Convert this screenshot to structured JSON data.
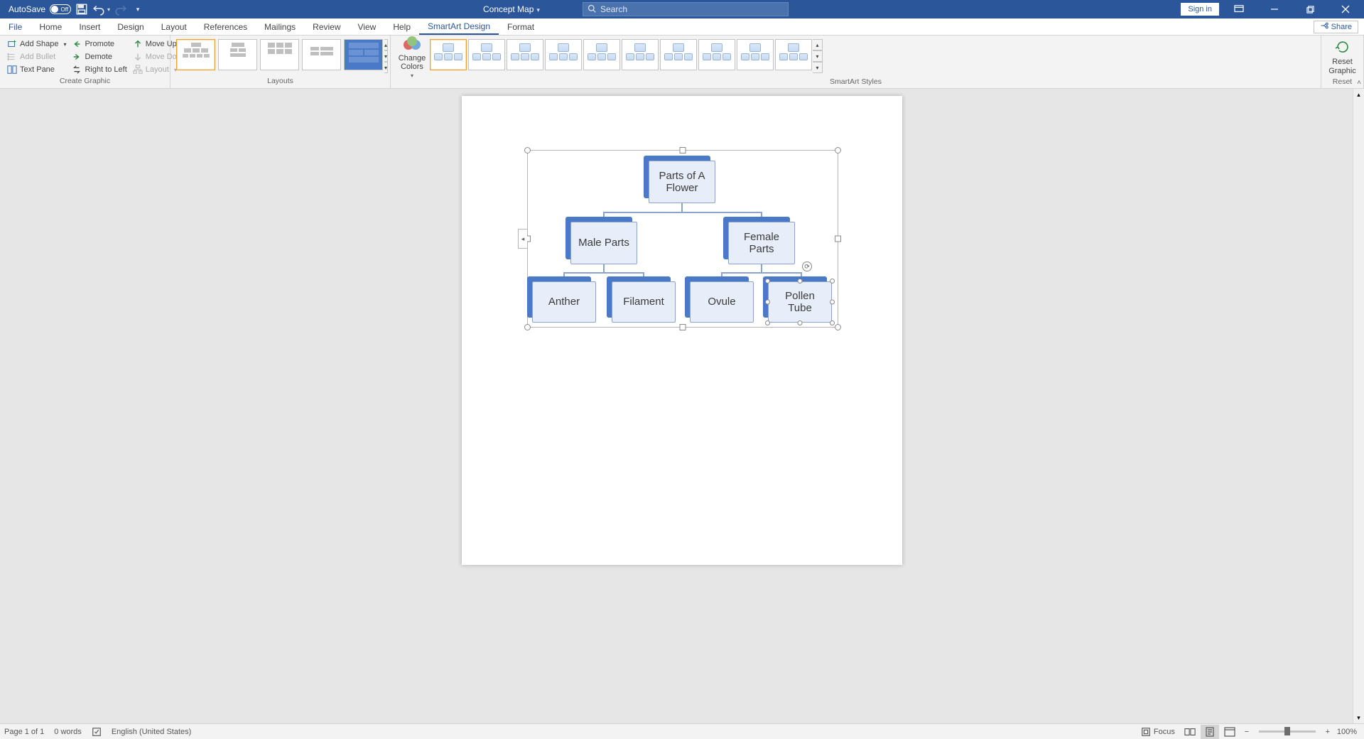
{
  "titlebar": {
    "autosave_label": "AutoSave",
    "autosave_state": "Off",
    "doc_title": "Concept Map",
    "search_placeholder": "Search",
    "signin_label": "Sign in"
  },
  "tabs": {
    "file": "File",
    "home": "Home",
    "insert": "Insert",
    "design": "Design",
    "layout": "Layout",
    "references": "References",
    "mailings": "Mailings",
    "review": "Review",
    "view": "View",
    "help": "Help",
    "smartart": "SmartArt Design",
    "format": "Format",
    "share": "Share"
  },
  "ribbon": {
    "create_graphic": {
      "label": "Create Graphic",
      "add_shape": "Add Shape",
      "add_bullet": "Add Bullet",
      "text_pane": "Text Pane",
      "promote": "Promote",
      "demote": "Demote",
      "right_to_left": "Right to Left",
      "move_up": "Move Up",
      "move_down": "Move Down",
      "layout_btn": "Layout"
    },
    "layouts": {
      "label": "Layouts"
    },
    "styles": {
      "label": "SmartArt Styles",
      "change_colors": "Change Colors"
    },
    "reset": {
      "label": "Reset",
      "reset_graphic": "Reset Graphic"
    }
  },
  "smartart": {
    "root": "Parts of A Flower",
    "l2a": "Male Parts",
    "l2b": "Female Parts",
    "l3a": "Anther",
    "l3b": "Filament",
    "l3c": "Ovule",
    "l3d": "Pollen Tube"
  },
  "statusbar": {
    "page": "Page 1 of 1",
    "words": "0 words",
    "language": "English (United States)",
    "focus": "Focus",
    "zoom": "100%"
  }
}
